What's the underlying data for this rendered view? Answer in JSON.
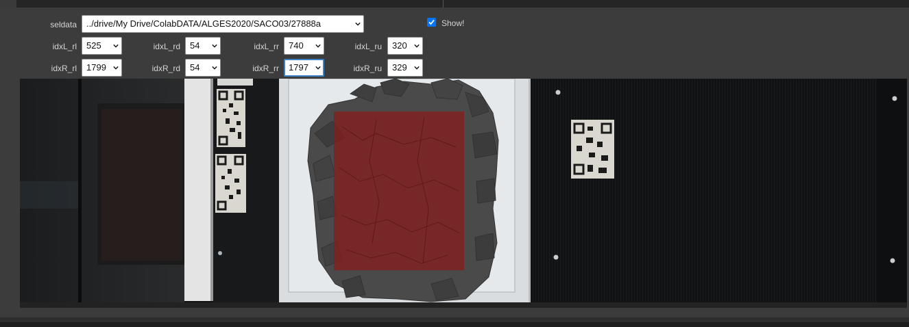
{
  "controls": {
    "seldata": {
      "label": "seldata",
      "value": "../drive/My Drive/ColabDATA/ALGES2020/SACO03/27888a"
    },
    "show": {
      "label": "Show!",
      "checked": true
    },
    "rows": [
      [
        {
          "label": "idxL_rl",
          "value": "525"
        },
        {
          "label": "idxL_rd",
          "value": "54"
        },
        {
          "label": "idxL_rr",
          "value": "740"
        },
        {
          "label": "idxL_ru",
          "value": "320"
        }
      ],
      [
        {
          "label": "idxR_rl",
          "value": "1799"
        },
        {
          "label": "idxR_rd",
          "value": "54"
        },
        {
          "label": "idxR_rr",
          "value": "1797"
        },
        {
          "label": "idxR_ru",
          "value": "329"
        }
      ]
    ]
  },
  "colors": {
    "checkbox_accent": "#0075ff",
    "overlay": "#8b1a1a",
    "tray": "#d9dde0",
    "conveyor": "#141618"
  }
}
